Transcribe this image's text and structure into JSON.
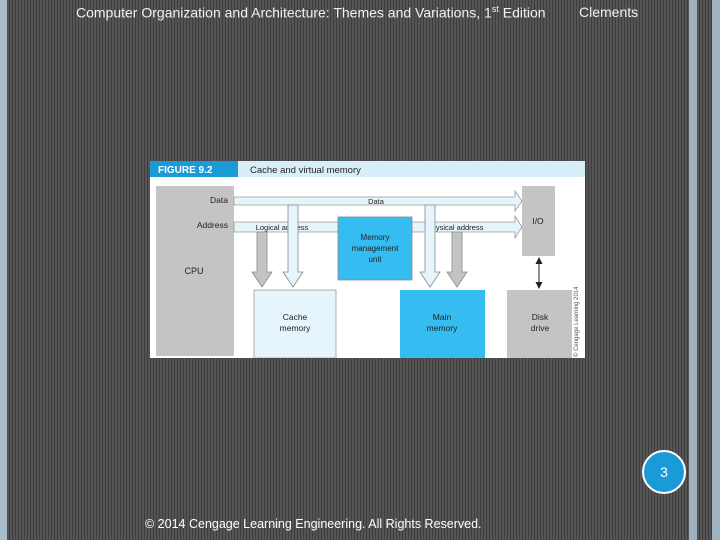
{
  "header": {
    "title": "Computer Organization and Architecture: Themes and Variations, 1",
    "title_sup": "st",
    "title_end": " Edition",
    "author": "Clements"
  },
  "figure": {
    "label": "FIGURE 9.2",
    "caption": "Cache and virtual memory",
    "cpu_labels": {
      "data": "Data",
      "address": "Address",
      "cpu": "CPU"
    },
    "bus_labels": {
      "data": "Data",
      "logical": "Logical address",
      "physical": "Physical address"
    },
    "mmu": [
      "Memory",
      "management",
      "unit"
    ],
    "io": "I/O",
    "cache": [
      "Cache",
      "memory"
    ],
    "main": [
      "Main",
      "memory"
    ],
    "disk": [
      "Disk",
      "drive"
    ],
    "copyright": "© Cengage Learning 2014"
  },
  "page_number": "3",
  "footer": "© 2014 Cengage Learning Engineering. All Rights Reserved.",
  "colors": {
    "figure_label_bg": "#1a9ad6",
    "header_strip": "#d8eef9",
    "blue_box": "#35bcf0",
    "gray_block": "#c4c4c4",
    "bus": "#e6f4fb"
  }
}
